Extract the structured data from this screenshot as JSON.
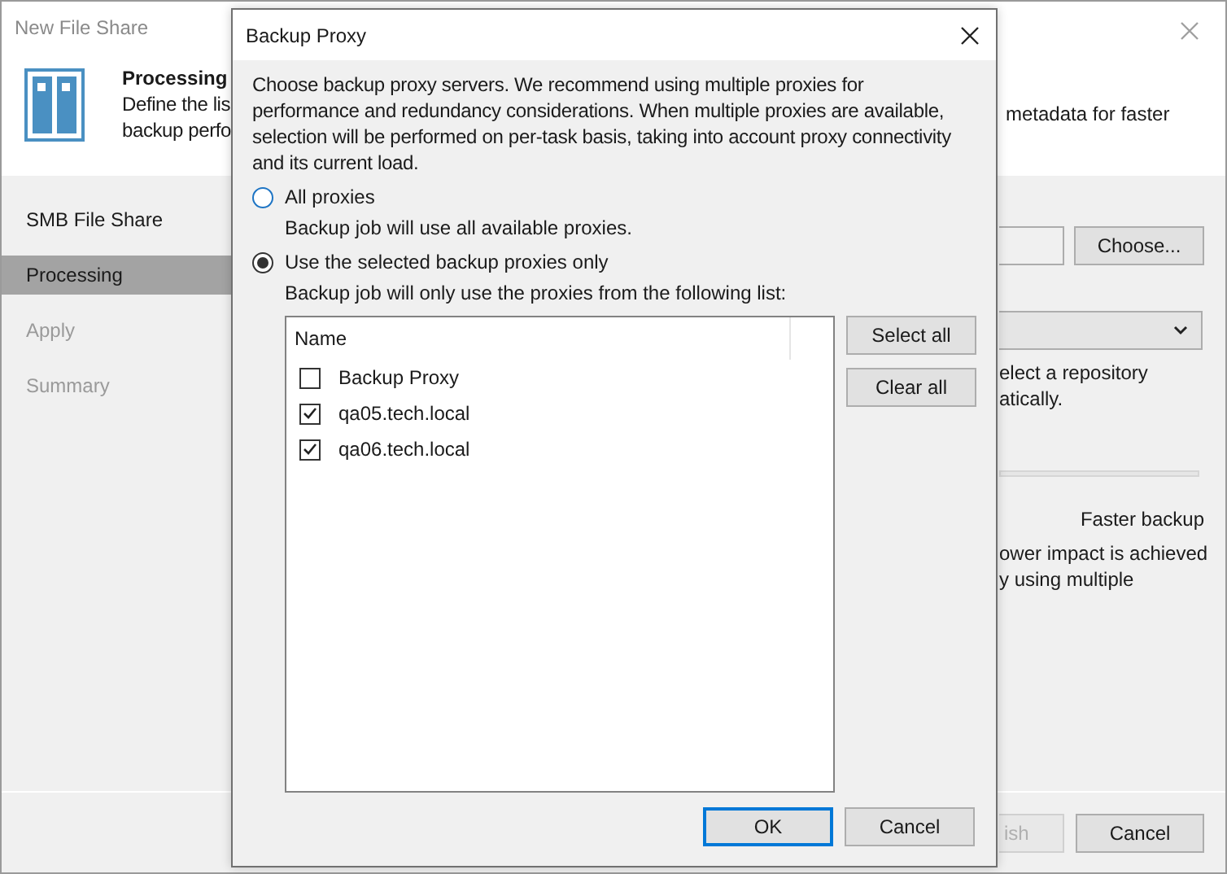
{
  "window": {
    "title": "New File Share"
  },
  "header": {
    "title": "Processing",
    "description_lines": [
      "Define the lis",
      "backup perfo"
    ]
  },
  "steps": [
    {
      "label": "SMB File Share",
      "selected": false,
      "disabled": false
    },
    {
      "label": "Processing",
      "selected": true,
      "disabled": false
    },
    {
      "label": "Apply",
      "selected": false,
      "disabled": true
    },
    {
      "label": "Summary",
      "selected": false,
      "disabled": true
    }
  ],
  "right_pane": {
    "header_tail": "metadata for faster",
    "choose_button": "Choose...",
    "hint_lines": [
      "elect a repository",
      "atically."
    ],
    "slider_label": "Faster backup",
    "note_lines": [
      "ower impact is achieved",
      "y using multiple"
    ]
  },
  "footer_buttons": [
    {
      "label": "ish",
      "disabled": true
    },
    {
      "label": "Cancel",
      "disabled": false
    }
  ],
  "dialog": {
    "title": "Backup Proxy",
    "intro": "Choose backup proxy servers. We recommend using multiple proxies for performance and redundancy considerations. When multiple proxies are available, selection will be performed on per-task basis, taking into account proxy connectivity and its current load.",
    "options": [
      {
        "label": "All proxies",
        "description": "Backup job will use all available proxies.",
        "selected": false
      },
      {
        "label": "Use the selected backup proxies only",
        "description": "Backup job will only use the proxies from the following list:",
        "selected": true
      }
    ],
    "list": {
      "column": "Name",
      "rows": [
        {
          "label": "Backup Proxy",
          "checked": false
        },
        {
          "label": "qa05.tech.local",
          "checked": true
        },
        {
          "label": "qa06.tech.local",
          "checked": true
        }
      ]
    },
    "side_buttons": [
      "Select all",
      "Clear all"
    ],
    "buttons": [
      {
        "label": "OK",
        "default": true
      },
      {
        "label": "Cancel",
        "default": false
      }
    ]
  }
}
